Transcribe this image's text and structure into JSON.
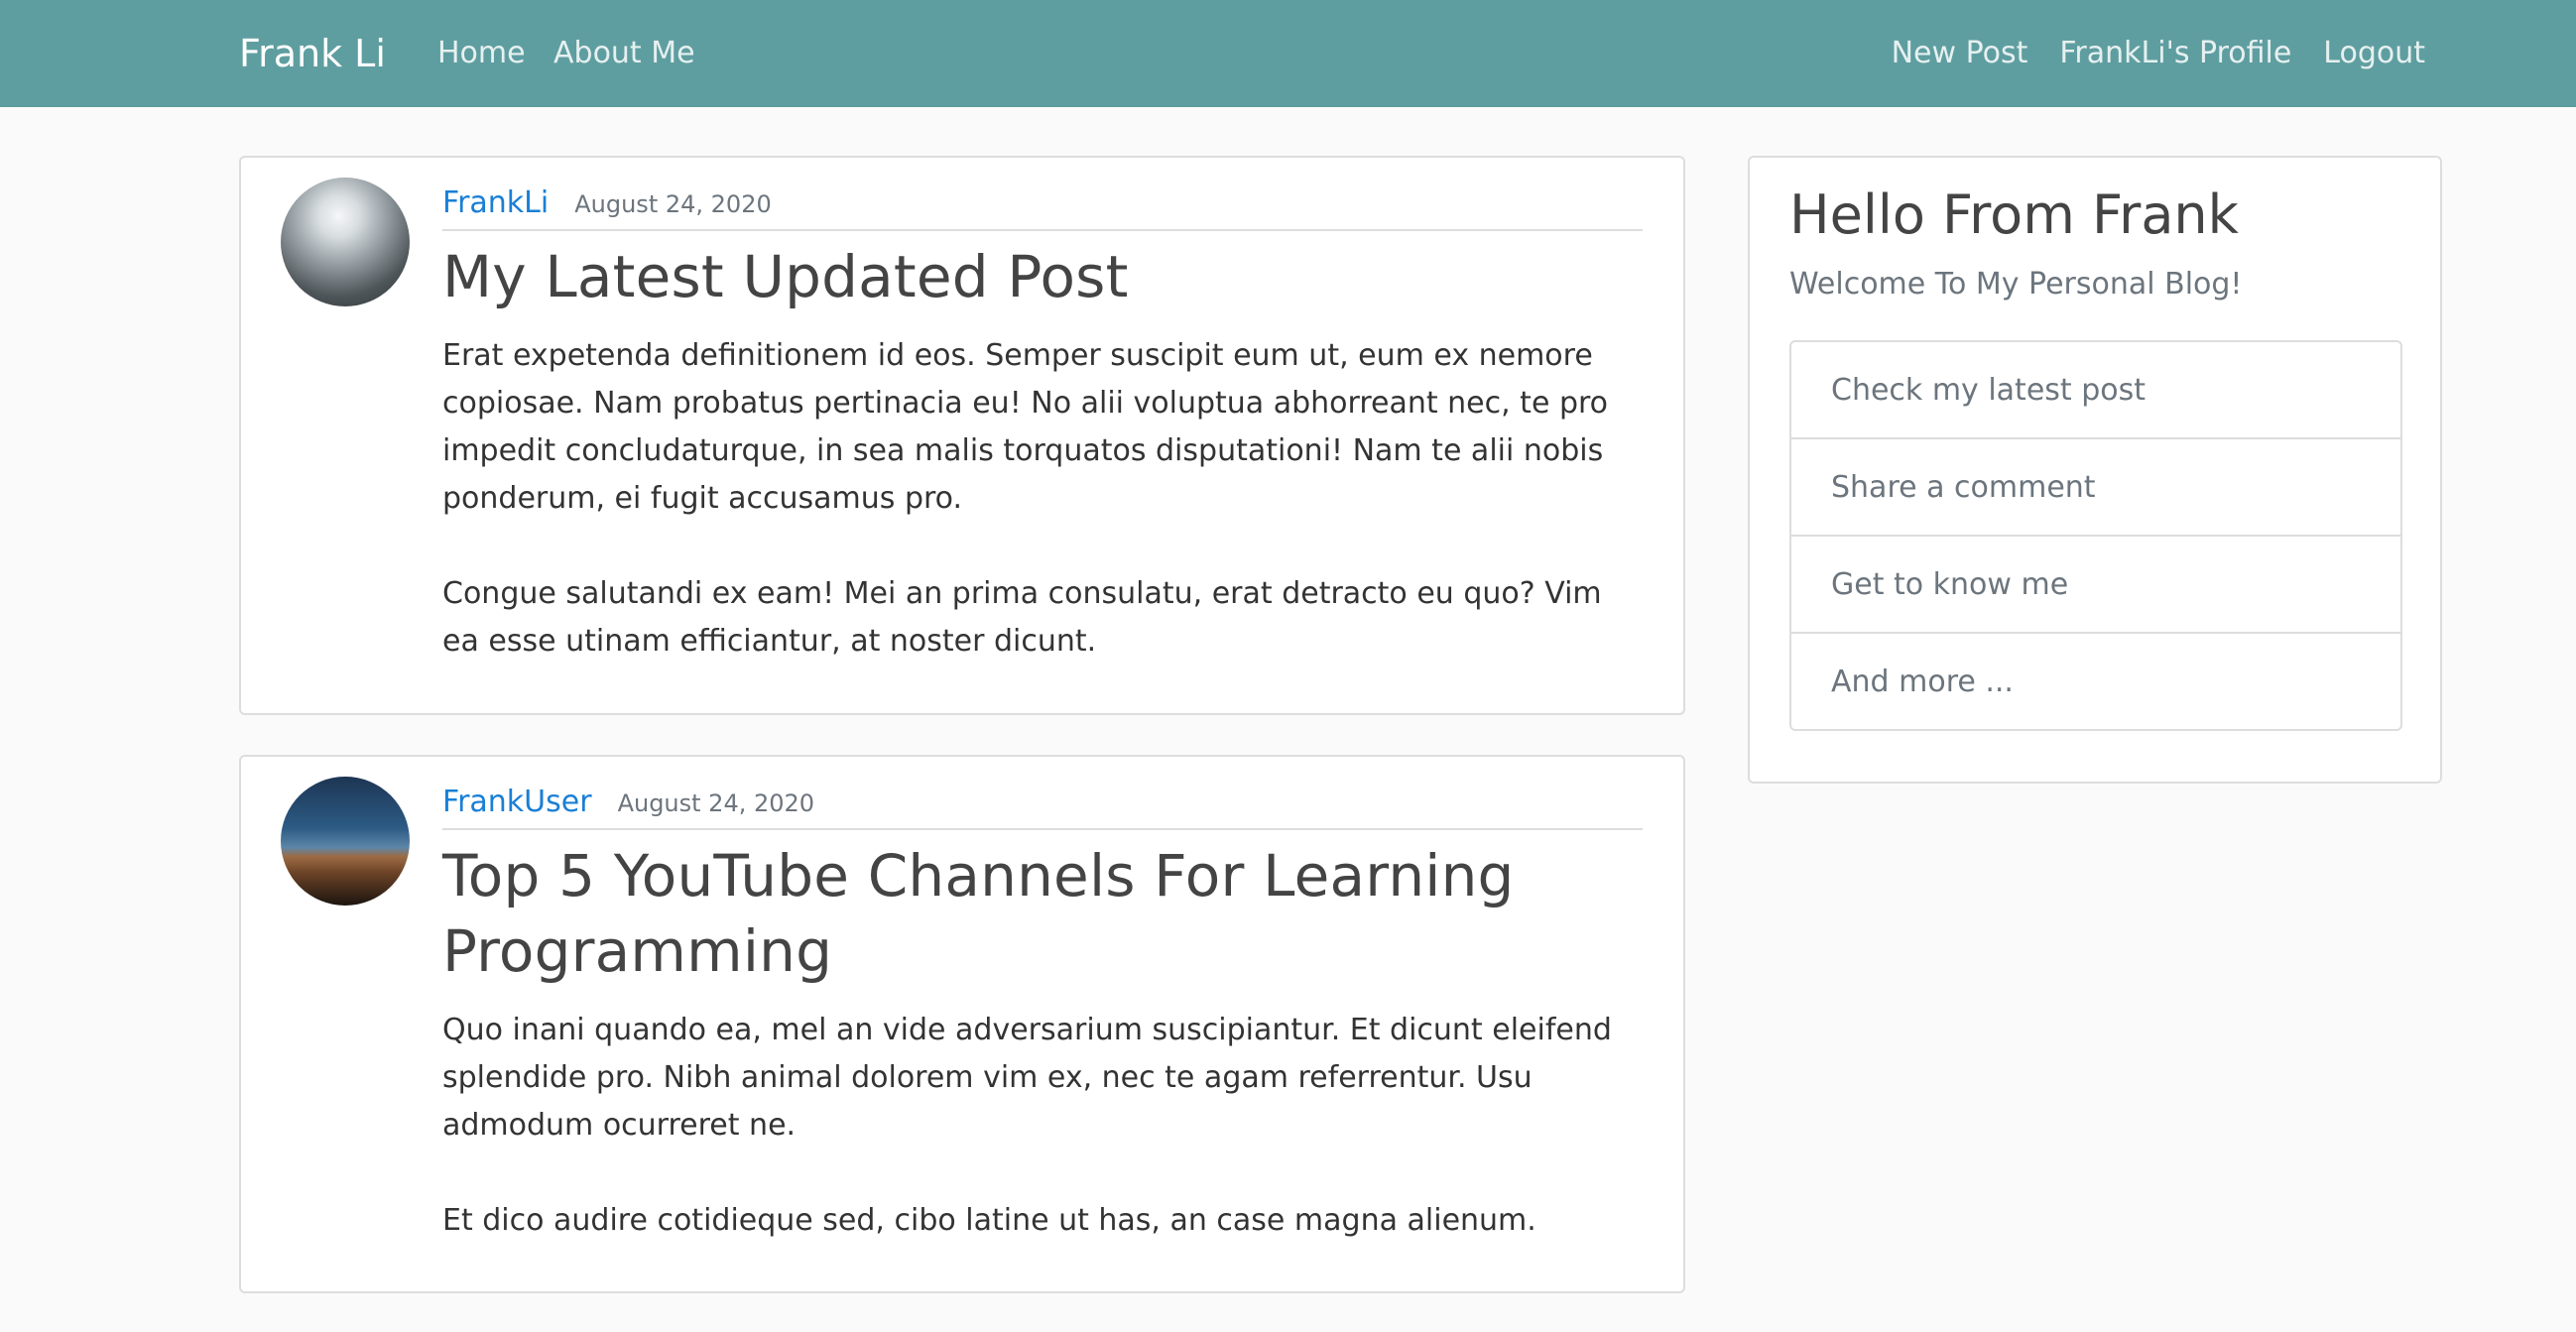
{
  "navbar": {
    "brand": "Frank Li",
    "left_links": [
      "Home",
      "About Me"
    ],
    "right_links": [
      "New Post",
      "FrankLi's Profile",
      "Logout"
    ],
    "background_color": "#5f9ea0"
  },
  "posts": [
    {
      "author": "FrankLi",
      "date": "August 24, 2020",
      "title": "My Latest Updated Post",
      "paragraphs": [
        "Erat expetenda definitionem id eos. Semper suscipit eum ut, eum ex nemore copiosae. Nam probatus pertinacia eu! No alii voluptua abhorreant nec, te pro impedit concludaturque, in sea malis torquatos disputationi! Nam te alii nobis ponderum, ei fugit accusamus pro.",
        "Congue salutandi ex eam! Mei an prima consulatu, erat detracto eu quo? Vim ea esse utinam efficiantur, at noster dicunt."
      ]
    },
    {
      "author": "FrankUser",
      "date": "August 24, 2020",
      "title": "Top 5 YouTube Channels For Learning Programming",
      "paragraphs": [
        "Quo inani quando ea, mel an vide adversarium suscipiantur. Et dicunt eleifend splendide pro. Nibh animal dolorem vim ex, nec te agam referrentur. Usu admodum ocurreret ne.",
        "Et dico audire cotidieque sed, cibo latine ut has, an case magna alienum."
      ]
    }
  ],
  "sidebar": {
    "title": "Hello From Frank",
    "subtitle": "Welcome To My Personal Blog!",
    "items": [
      "Check my latest post",
      "Share a comment",
      "Get to know me",
      "And more ..."
    ]
  },
  "colors": {
    "link_blue": "#1a7fd6",
    "muted_text": "#6c757d",
    "border": "#dddddd",
    "page_background": "#fafafa"
  }
}
